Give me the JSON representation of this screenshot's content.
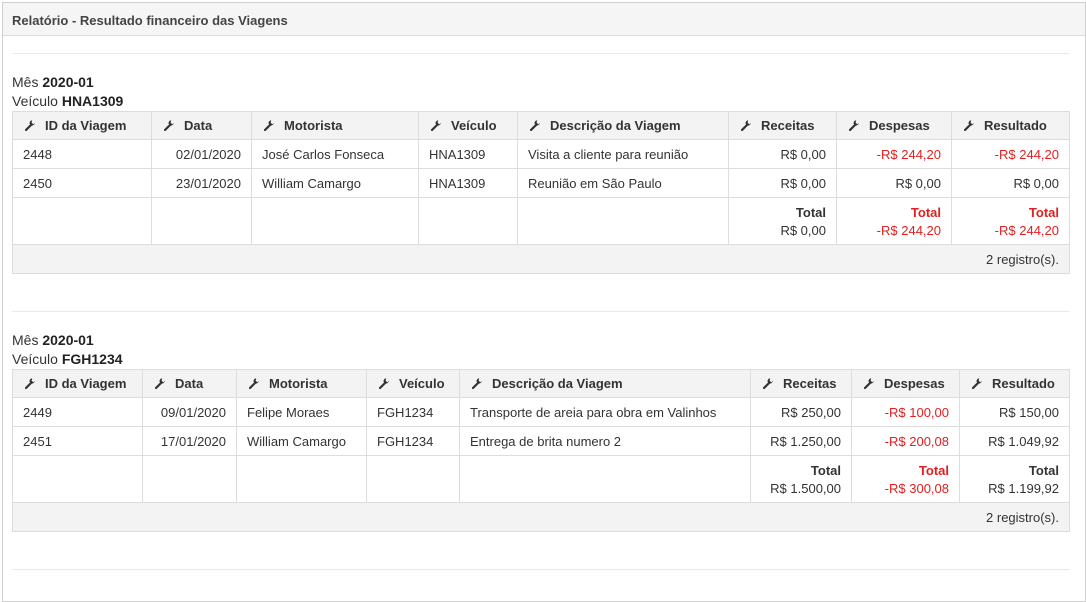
{
  "panel": {
    "title": "Relatório - Resultado financeiro das Viagens"
  },
  "columns": [
    "ID da Viagem",
    "Data",
    "Motorista",
    "Veículo",
    "Descrição da Viagem",
    "Receitas",
    "Despesas",
    "Resultado"
  ],
  "groups": [
    {
      "month_label": "Mês",
      "month": "2020-01",
      "vehicle_label": "Veículo",
      "vehicle": "HNA1309",
      "rows": [
        {
          "id": "2448",
          "date": "02/01/2020",
          "driver": "José Carlos Fonseca",
          "vehicle": "HNA1309",
          "description": "Visita a cliente para reunião",
          "revenue": "R$ 0,00",
          "expenses": "-R$ 244,20",
          "result": "-R$ 244,20"
        },
        {
          "id": "2450",
          "date": "23/01/2020",
          "driver": "William Camargo",
          "vehicle": "HNA1309",
          "description": "Reunião em São Paulo",
          "revenue": "R$ 0,00",
          "expenses": "R$ 0,00",
          "result": "R$ 0,00"
        }
      ],
      "totals": {
        "label": "Total",
        "revenue": "R$ 0,00",
        "expenses": "-R$ 244,20",
        "result": "-R$ 244,20"
      },
      "count": "2 registro(s)."
    },
    {
      "month_label": "Mês",
      "month": "2020-01",
      "vehicle_label": "Veículo",
      "vehicle": "FGH1234",
      "rows": [
        {
          "id": "2449",
          "date": "09/01/2020",
          "driver": "Felipe Moraes",
          "vehicle": "FGH1234",
          "description": "Transporte de areia para obra em Valinhos",
          "revenue": "R$ 250,00",
          "expenses": "-R$ 100,00",
          "result": "R$ 150,00"
        },
        {
          "id": "2451",
          "date": "17/01/2020",
          "driver": "William Camargo",
          "vehicle": "FGH1234",
          "description": "Entrega de brita numero 2",
          "revenue": "R$ 1.250,00",
          "expenses": "-R$ 200,08",
          "result": "R$ 1.049,92"
        }
      ],
      "totals": {
        "label": "Total",
        "revenue": "R$ 1.500,00",
        "expenses": "-R$ 300,08",
        "result": "R$ 1.199,92"
      },
      "count": "2 registro(s)."
    }
  ],
  "colors": {
    "negative": "#e02020",
    "header_bg": "#f3f3f3",
    "border": "#dddddd"
  },
  "icons": {
    "column_header": "wrench-icon"
  }
}
